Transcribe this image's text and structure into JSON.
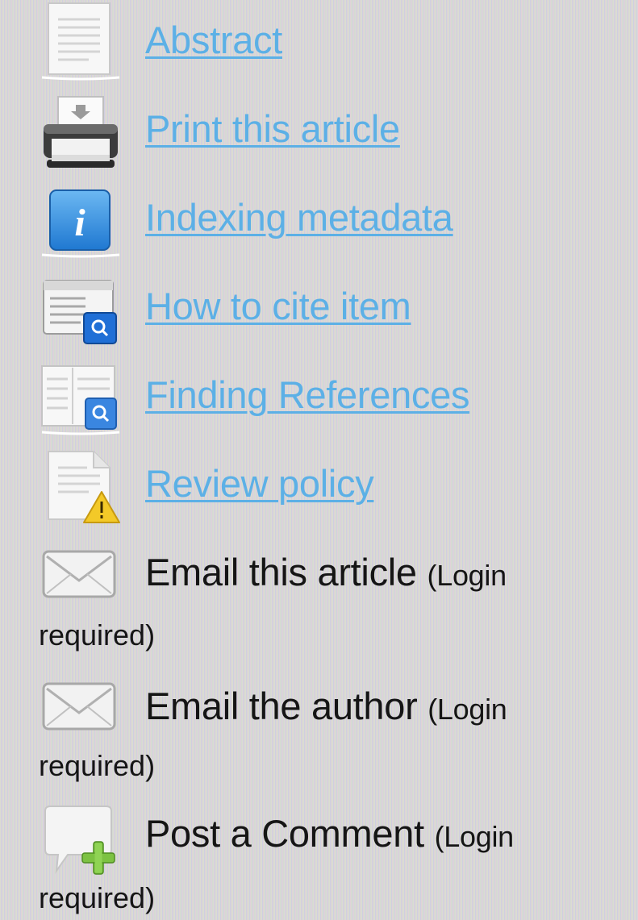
{
  "reading_tools": [
    {
      "icon": "abstract-document-icon",
      "label": "Abstract",
      "is_link": true
    },
    {
      "icon": "printer-icon",
      "label": "Print this article",
      "is_link": true
    },
    {
      "icon": "info-icon",
      "label": "Indexing metadata",
      "is_link": true
    },
    {
      "icon": "cite-item-icon",
      "label": "How to cite item",
      "is_link": true
    },
    {
      "icon": "finding-references-icon",
      "label": "Finding References",
      "is_link": true
    },
    {
      "icon": "review-policy-warning-icon",
      "label": "Review policy",
      "is_link": true
    },
    {
      "icon": "envelope-icon",
      "label": "Email this article",
      "note_part1": "(Login",
      "note_part2": "required)",
      "is_link": false
    },
    {
      "icon": "envelope-icon",
      "label": "Email the author",
      "note_part1": "(Login",
      "note_part2": "required)",
      "is_link": false
    },
    {
      "icon": "comment-add-icon",
      "label": "Post a Comment",
      "note_part1": "(Login",
      "note_part2": "required)",
      "is_link": false
    }
  ]
}
